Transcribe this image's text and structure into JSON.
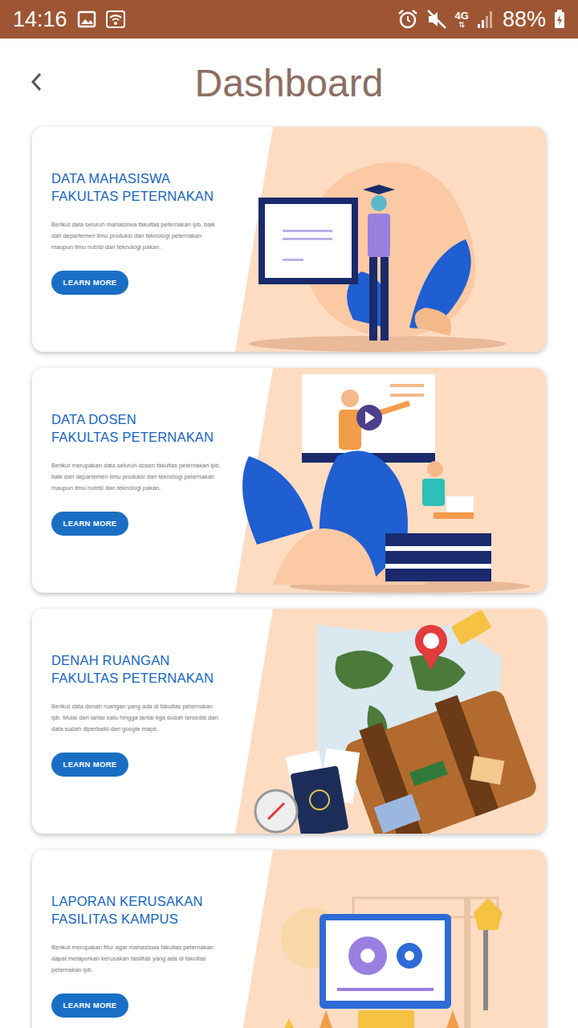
{
  "status_bar": {
    "time": "14:16",
    "network": "4G",
    "battery": "88%"
  },
  "header": {
    "title": "Dashboard"
  },
  "cards": [
    {
      "kind": "student",
      "title_lines": [
        "DATA MAHASISWA",
        "FAKULTAS PETERNAKAN"
      ],
      "description": "Berikut data seluruh mahasiswa fakultas peternakan ipb, baik dari departemen ilmu produksi dan teknologi peternakan maupun ilmu nutrisi dan teknologi pakan.",
      "button": "LEARN MORE"
    },
    {
      "kind": "lecturer",
      "title_lines": [
        "DATA DOSEN",
        "FAKULTAS PETERNAKAN"
      ],
      "description": "Berikut merupakan data seluruh dosen fakultas peternakan ipb, baik dari departemen ilmu produksi dan teknologi peternakan maupun ilmu nutrisi dan teknologi pakan.",
      "button": "LEARN MORE"
    },
    {
      "kind": "map",
      "title_lines": [
        "DENAH RUANGAN",
        "FAKULTAS PETERNAKAN"
      ],
      "description": "Berikut data denah ruangan yang ada di fakultas peternakan ipb. Mulai dari lantai satu hingga lantai tiga sudah tersedia dan data sudah diperbaiki dari google maps.",
      "button": "LEARN MORE"
    },
    {
      "kind": "report",
      "title_lines": [
        "LAPORAN KERUSAKAN",
        "FASILITAS KAMPUS"
      ],
      "description": "Berikut merupakan fitur agar mahasiswa fakultas peternakan dapat melaporkan kerusakan fasilitas yang ada di fakultas peternakan ipb.",
      "button": "LEARN MORE"
    }
  ]
}
